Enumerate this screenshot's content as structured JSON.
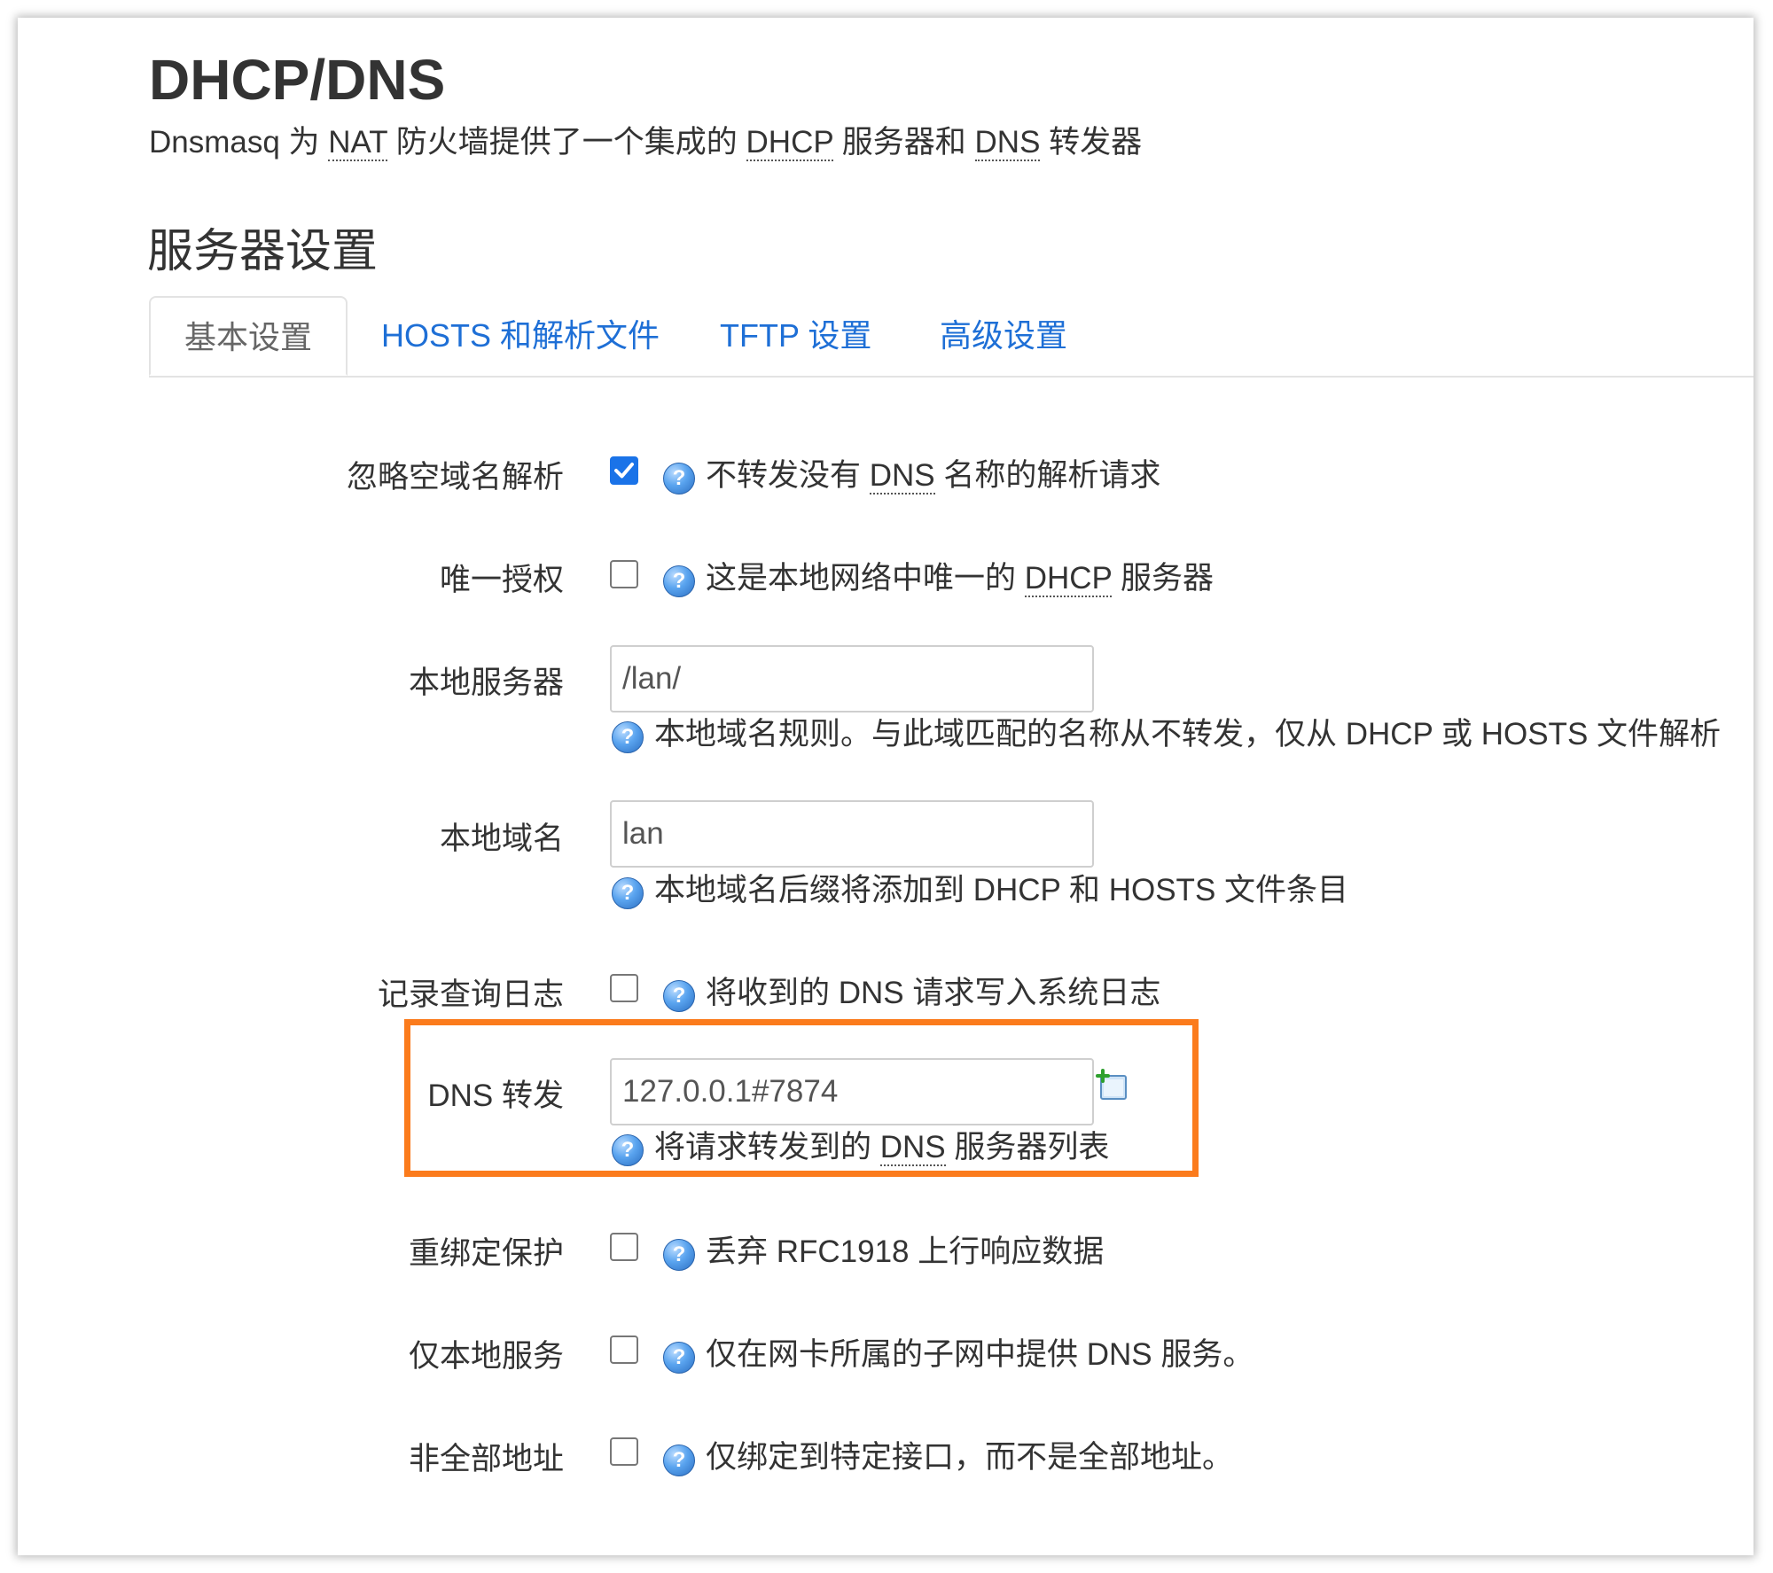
{
  "header": {
    "title": "DHCP/DNS",
    "desc": {
      "p1": "Dnsmasq 为 ",
      "nat": "NAT",
      "p2": " 防火墙提供了一个集成的 ",
      "dhcp": "DHCP",
      "p3": " 服务器和 ",
      "dns": "DNS",
      "p4": " 转发器"
    }
  },
  "section": {
    "title": "服务器设置"
  },
  "tabs": [
    {
      "label": "基本设置",
      "active": true
    },
    {
      "label": "HOSTS 和解析文件",
      "active": false
    },
    {
      "label": "TFTP 设置",
      "active": false
    },
    {
      "label": "高级设置",
      "active": false
    }
  ],
  "fields": {
    "domain_needed": {
      "label": "忽略空域名解析",
      "checked": true,
      "help": {
        "p1": "不转发没有 ",
        "abbr": "DNS",
        "p2": " 名称的解析请求"
      }
    },
    "authoritative": {
      "label": "唯一授权",
      "checked": false,
      "help": {
        "p1": "这是本地网络中唯一的 ",
        "abbr": "DHCP",
        "p2": " 服务器"
      }
    },
    "local_server": {
      "label": "本地服务器",
      "value": "/lan/",
      "help": "本地域名规则。与此域匹配的名称从不转发，仅从 DHCP 或 HOSTS 文件解析"
    },
    "local_domain": {
      "label": "本地域名",
      "value": "lan",
      "help": "本地域名后缀将添加到 DHCP 和 HOSTS 文件条目"
    },
    "log_queries": {
      "label": "记录查询日志",
      "checked": false,
      "help": "将收到的 DNS 请求写入系统日志"
    },
    "dns_forward": {
      "label": "DNS 转发",
      "value": "127.0.0.1#7874",
      "help": {
        "p1": "将请求转发到的 ",
        "abbr": "DNS",
        "p2": " 服务器列表"
      }
    },
    "rebind_protection": {
      "label": "重绑定保护",
      "checked": false,
      "help": "丢弃 RFC1918 上行响应数据"
    },
    "local_service": {
      "label": "仅本地服务",
      "checked": false,
      "help": "仅在网卡所属的子网中提供 DNS 服务。"
    },
    "nonwildcard": {
      "label": "非全部地址",
      "checked": false,
      "help": "仅绑定到特定接口，而不是全部地址。"
    }
  },
  "colors": {
    "accent": "#1a73e8",
    "link": "#1e6fd6",
    "highlight": "#fb7b1c"
  }
}
